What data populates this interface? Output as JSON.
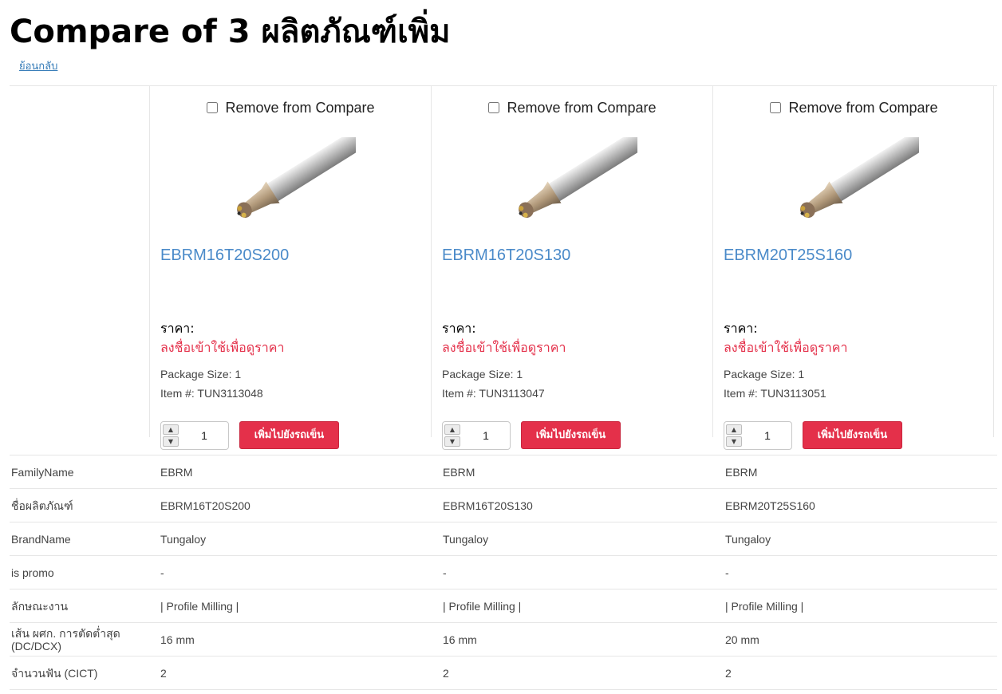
{
  "page": {
    "title": "Compare of 3 ผลิตภัณฑ์เพิ่ม",
    "back_link": "ย้อนกลับ"
  },
  "colors": {
    "link_blue": "#4a8ac9",
    "accent_red": "#e4304a",
    "border": "#e6e6e6"
  },
  "products": [
    {
      "remove_label": "Remove from Compare",
      "name": "EBRM16T20S200",
      "price_label": "ราคา:",
      "price_text": "ลงชื่อเข้าใช้เพื่อดูราคา",
      "package": "Package Size: 1",
      "item": "Item #: TUN3113048",
      "qty": "1",
      "add_label": "เพิ่มไปยังรถเข็น"
    },
    {
      "remove_label": "Remove from Compare",
      "name": "EBRM16T20S130",
      "price_label": "ราคา:",
      "price_text": "ลงชื่อเข้าใช้เพื่อดูราคา",
      "package": "Package Size: 1",
      "item": "Item #: TUN3113047",
      "qty": "1",
      "add_label": "เพิ่มไปยังรถเข็น"
    },
    {
      "remove_label": "Remove from Compare",
      "name": "EBRM20T25S160",
      "price_label": "ราคา:",
      "price_text": "ลงชื่อเข้าใช้เพื่อดูราคา",
      "package": "Package Size: 1",
      "item": "Item #: TUN3113051",
      "qty": "1",
      "add_label": "เพิ่มไปยังรถเข็น"
    }
  ],
  "specs": [
    {
      "label": "FamilyName",
      "values": [
        "EBRM",
        "EBRM",
        "EBRM"
      ]
    },
    {
      "label": "ชื่อผลิตภัณฑ์",
      "values": [
        "EBRM16T20S200",
        "EBRM16T20S130",
        "EBRM20T25S160"
      ]
    },
    {
      "label": "BrandName",
      "values": [
        "Tungaloy",
        "Tungaloy",
        "Tungaloy"
      ]
    },
    {
      "label": "is promo",
      "values": [
        "-",
        "-",
        "-"
      ]
    },
    {
      "label": "ลักษณะงาน",
      "values": [
        "| Profile Milling |",
        "| Profile Milling |",
        "| Profile Milling |"
      ]
    },
    {
      "label": "เส้น ผศก. การตัดต่ำสุด (DC/DCX)",
      "values": [
        "16 mm",
        "16 mm",
        "20 mm"
      ]
    },
    {
      "label": "จำนวนฟัน (CICT)",
      "values": [
        "2",
        "2",
        "2"
      ]
    }
  ]
}
